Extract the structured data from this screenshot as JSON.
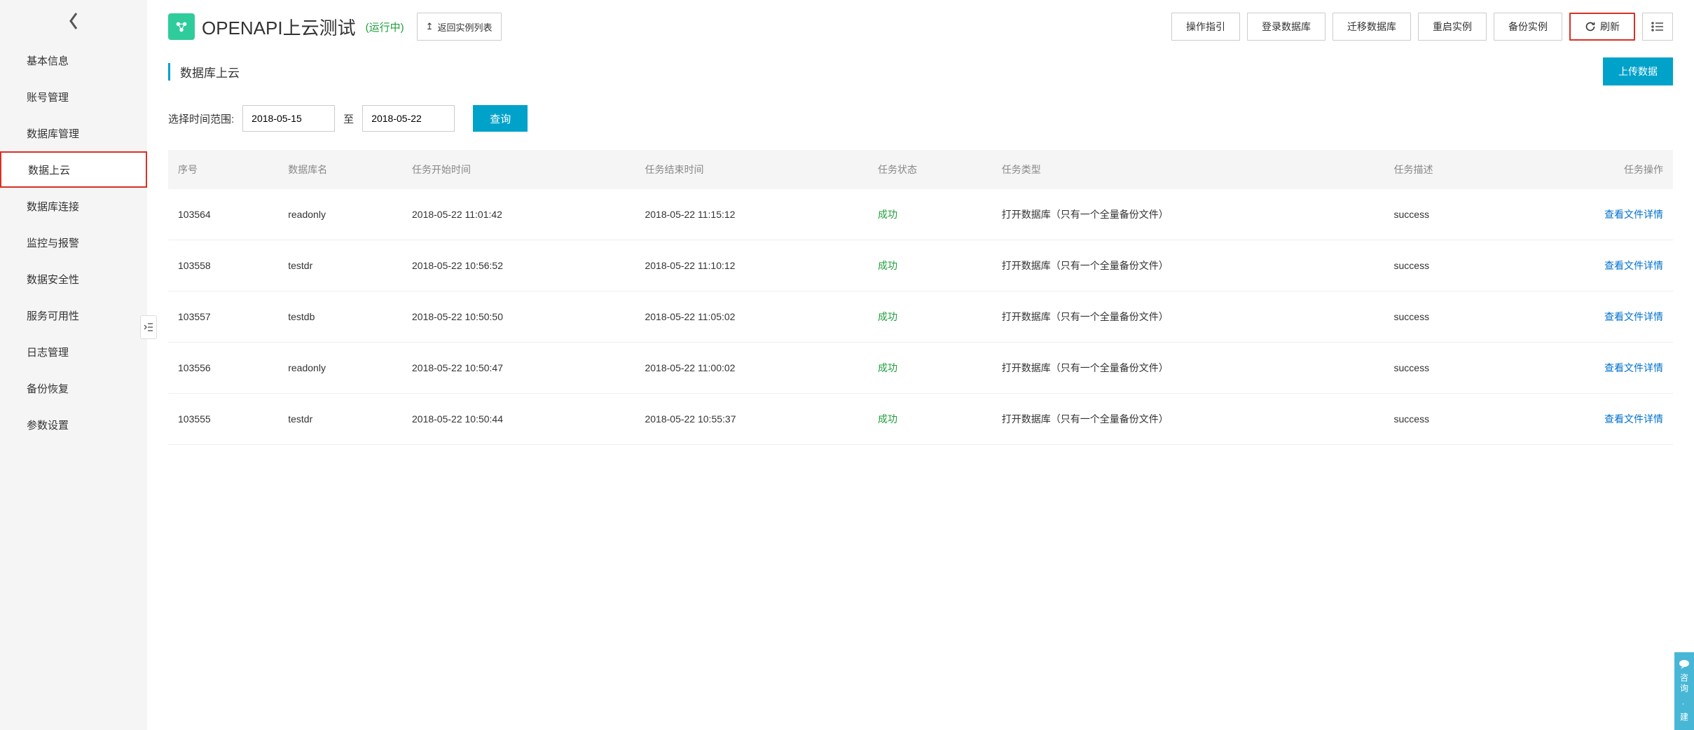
{
  "header": {
    "title": "OPENAPI上云测试",
    "status": "(运行中)",
    "back_list": "返回实例列表",
    "buttons": {
      "guide": "操作指引",
      "login_db": "登录数据库",
      "migrate_db": "迁移数据库",
      "restart": "重启实例",
      "backup": "备份实例",
      "refresh": "刷新"
    }
  },
  "sidebar": {
    "items": [
      {
        "label": "基本信息"
      },
      {
        "label": "账号管理"
      },
      {
        "label": "数据库管理"
      },
      {
        "label": "数据上云"
      },
      {
        "label": "数据库连接"
      },
      {
        "label": "监控与报警"
      },
      {
        "label": "数据安全性"
      },
      {
        "label": "服务可用性"
      },
      {
        "label": "日志管理"
      },
      {
        "label": "备份恢复"
      },
      {
        "label": "参数设置"
      }
    ]
  },
  "section": {
    "title": "数据库上云",
    "upload_btn": "上传数据"
  },
  "filter": {
    "label": "选择时间范围:",
    "date_from": "2018-05-15",
    "sep": "至",
    "date_to": "2018-05-22",
    "query": "查询"
  },
  "table": {
    "columns": [
      "序号",
      "数据库名",
      "任务开始时间",
      "任务结束时间",
      "任务状态",
      "任务类型",
      "任务描述",
      "任务操作"
    ],
    "action_label": "查看文件详情",
    "rows": [
      {
        "id": "103564",
        "db": "readonly",
        "start": "2018-05-22 11:01:42",
        "end": "2018-05-22 11:15:12",
        "status": "成功",
        "type": "打开数据库（只有一个全量备份文件）",
        "desc": "success"
      },
      {
        "id": "103558",
        "db": "testdr",
        "start": "2018-05-22 10:56:52",
        "end": "2018-05-22 11:10:12",
        "status": "成功",
        "type": "打开数据库（只有一个全量备份文件）",
        "desc": "success"
      },
      {
        "id": "103557",
        "db": "testdb",
        "start": "2018-05-22 10:50:50",
        "end": "2018-05-22 11:05:02",
        "status": "成功",
        "type": "打开数据库（只有一个全量备份文件）",
        "desc": "success"
      },
      {
        "id": "103556",
        "db": "readonly",
        "start": "2018-05-22 10:50:47",
        "end": "2018-05-22 11:00:02",
        "status": "成功",
        "type": "打开数据库（只有一个全量备份文件）",
        "desc": "success"
      },
      {
        "id": "103555",
        "db": "testdr",
        "start": "2018-05-22 10:50:44",
        "end": "2018-05-22 10:55:37",
        "status": "成功",
        "type": "打开数据库（只有一个全量备份文件）",
        "desc": "success"
      }
    ]
  },
  "sidetab": {
    "text": "咨询",
    "text2": "建"
  }
}
